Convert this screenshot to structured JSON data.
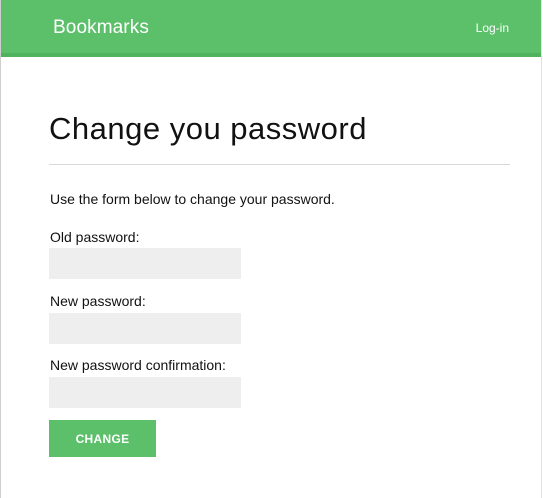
{
  "header": {
    "brand": "Bookmarks",
    "login_label": "Log-in"
  },
  "main": {
    "title": "Change you password",
    "intro": "Use the form below to change your password.",
    "fields": [
      {
        "label": "Old password:",
        "value": ""
      },
      {
        "label": "New password:",
        "value": ""
      },
      {
        "label": "New password confirmation:",
        "value": ""
      }
    ],
    "submit_label": "CHANGE"
  },
  "colors": {
    "accent": "#5cc06a",
    "input_background": "#eeeeee",
    "text": "#111111"
  }
}
